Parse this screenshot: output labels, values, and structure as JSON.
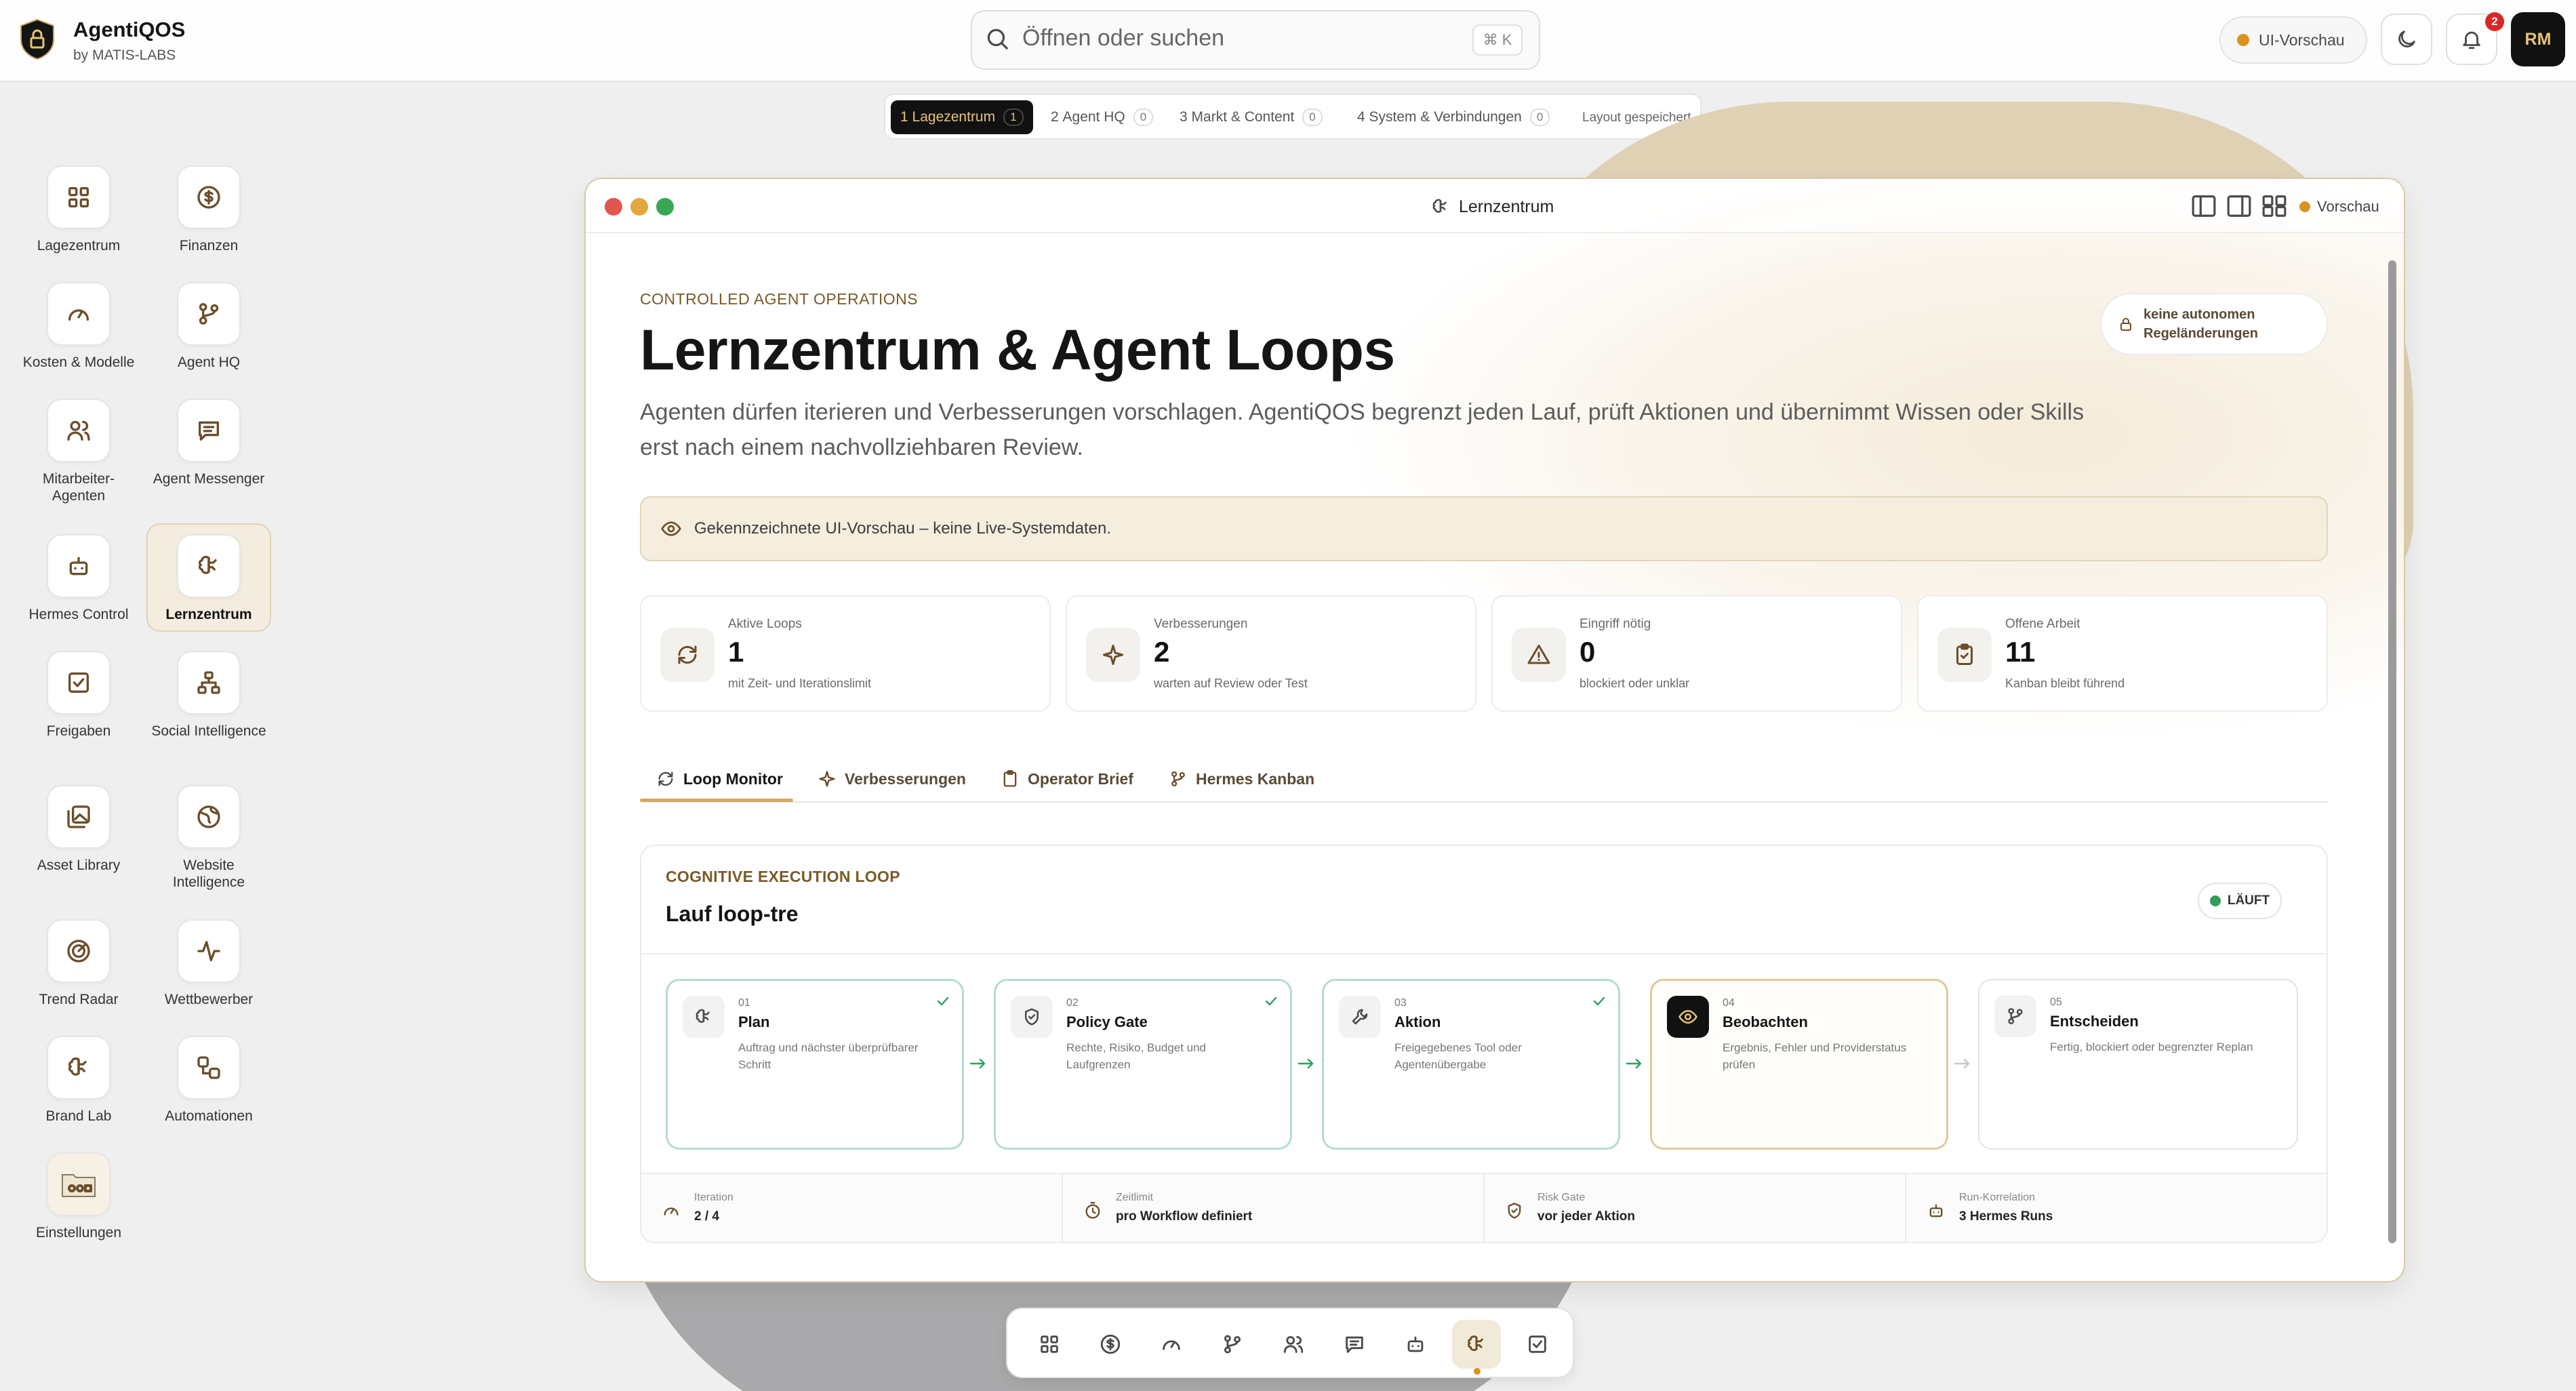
{
  "app": {
    "title": "AgentiQOS",
    "subtitle": "by MATIS-LABS"
  },
  "topbar": {
    "search_placeholder": "Öffnen oder suchen",
    "search_shortcut": "⌘ K",
    "preview_label": "UI-Vorschau",
    "notification_count": "2",
    "avatar_initials": "RM"
  },
  "layout_tabs": {
    "tabs": [
      {
        "num": "1",
        "label": "Lagezentrum",
        "count": "1",
        "active": true
      },
      {
        "num": "2",
        "label": "Agent HQ",
        "count": "0",
        "active": false
      },
      {
        "num": "3",
        "label": "Markt & Content",
        "count": "0",
        "active": false
      },
      {
        "num": "4",
        "label": "System & Verbindungen",
        "count": "0",
        "active": false
      }
    ],
    "saved_label": "Layout gespeichert"
  },
  "sidebar": {
    "items": [
      {
        "label": "Lagezentrum",
        "icon": "grid-icon"
      },
      {
        "label": "Finanzen",
        "icon": "dollar-icon"
      },
      {
        "label": "Kosten & Modelle",
        "icon": "gauge-icon"
      },
      {
        "label": "Agent HQ",
        "icon": "branch-icon"
      },
      {
        "label": "Mitarbeiter-Agenten",
        "icon": "users-icon"
      },
      {
        "label": "Agent Messenger",
        "icon": "message-icon"
      },
      {
        "label": "Hermes Control",
        "icon": "bot-icon"
      },
      {
        "label": "Lernzentrum",
        "icon": "brain-icon",
        "active": true
      },
      {
        "label": "Freigaben",
        "icon": "checkbox-icon"
      },
      {
        "label": "Social Intelligence",
        "icon": "network-icon"
      },
      {
        "label": "Asset Library",
        "icon": "images-icon"
      },
      {
        "label": "Website Intelligence",
        "icon": "globe-icon"
      },
      {
        "label": "Trend Radar",
        "icon": "radar-icon"
      },
      {
        "label": "Wettbewerber",
        "icon": "activity-icon"
      },
      {
        "label": "Brand Lab",
        "icon": "brain-icon"
      },
      {
        "label": "Automationen",
        "icon": "workflow-icon"
      },
      {
        "label": "Einstellungen",
        "icon": "folder-settings-icon"
      }
    ]
  },
  "window": {
    "title": "Lernzentrum",
    "preview_label": "Vorschau"
  },
  "page": {
    "kicker": "CONTROLLED AGENT OPERATIONS",
    "title": "Lernzentrum & Agent Loops",
    "description": "Agenten dürfen iterieren und Verbesserungen vorschlagen. AgentiQOS begrenzt jeden Lauf, prüft Aktionen und übernimmt Wissen oder Skills erst nach einem nachvollziehbaren Review.",
    "lock_line1": "keine autonomen",
    "lock_line2": "Regeländerungen",
    "notice": "Gekennzeichnete UI-Vorschau – keine Live-Systemdaten."
  },
  "stats": [
    {
      "label": "Aktive Loops",
      "value": "1",
      "sub": "mit Zeit- und Iterationslimit",
      "icon": "refresh-icon"
    },
    {
      "label": "Verbesserungen",
      "value": "2",
      "sub": "warten auf Review oder Test",
      "icon": "sparkles-icon"
    },
    {
      "label": "Eingriff nötig",
      "value": "0",
      "sub": "blockiert oder unklar",
      "icon": "warning-icon"
    },
    {
      "label": "Offene Arbeit",
      "value": "11",
      "sub": "Kanban bleibt führend",
      "icon": "clipboard-icon"
    }
  ],
  "content_tabs": [
    {
      "label": "Loop Monitor",
      "active": true
    },
    {
      "label": "Verbesserungen",
      "active": false
    },
    {
      "label": "Operator Brief",
      "active": false
    },
    {
      "label": "Hermes Kanban",
      "active": false
    }
  ],
  "loop": {
    "kicker": "COGNITIVE EXECUTION LOOP",
    "title": "Lauf loop-tre",
    "status": "LÄUFT",
    "steps": [
      {
        "num": "01",
        "title": "Plan",
        "desc": "Auftrag und nächster überprüfbarer Schritt",
        "state": "done"
      },
      {
        "num": "02",
        "title": "Policy Gate",
        "desc": "Rechte, Risiko, Budget und Laufgrenzen",
        "state": "done"
      },
      {
        "num": "03",
        "title": "Aktion",
        "desc": "Freigegebenes Tool oder Agentenübergabe",
        "state": "done"
      },
      {
        "num": "04",
        "title": "Beobachten",
        "desc": "Ergebnis, Fehler und Providerstatus prüfen",
        "state": "current"
      },
      {
        "num": "05",
        "title": "Entscheiden",
        "desc": "Fertig, blockiert oder begrenzter Replan",
        "state": "pending"
      }
    ],
    "footer": [
      {
        "label": "Iteration",
        "value": "2 / 4"
      },
      {
        "label": "Zeitlimit",
        "value": "pro Workflow definiert"
      },
      {
        "label": "Risk Gate",
        "value": "vor jeder Aktion"
      },
      {
        "label": "Run-Korrelation",
        "value": "3 Hermes Runs"
      }
    ]
  },
  "dock": {
    "items": [
      "grid-icon",
      "dollar-icon",
      "gauge-icon",
      "branch-icon",
      "users-icon",
      "message-icon",
      "bot-icon",
      "brain-icon",
      "checkbox-icon"
    ],
    "active_index": 7
  },
  "colors": {
    "accent": "#d6a960",
    "kicker": "#7a5a27",
    "done_border": "#b5dccf",
    "status_green": "#2e9e5b"
  }
}
